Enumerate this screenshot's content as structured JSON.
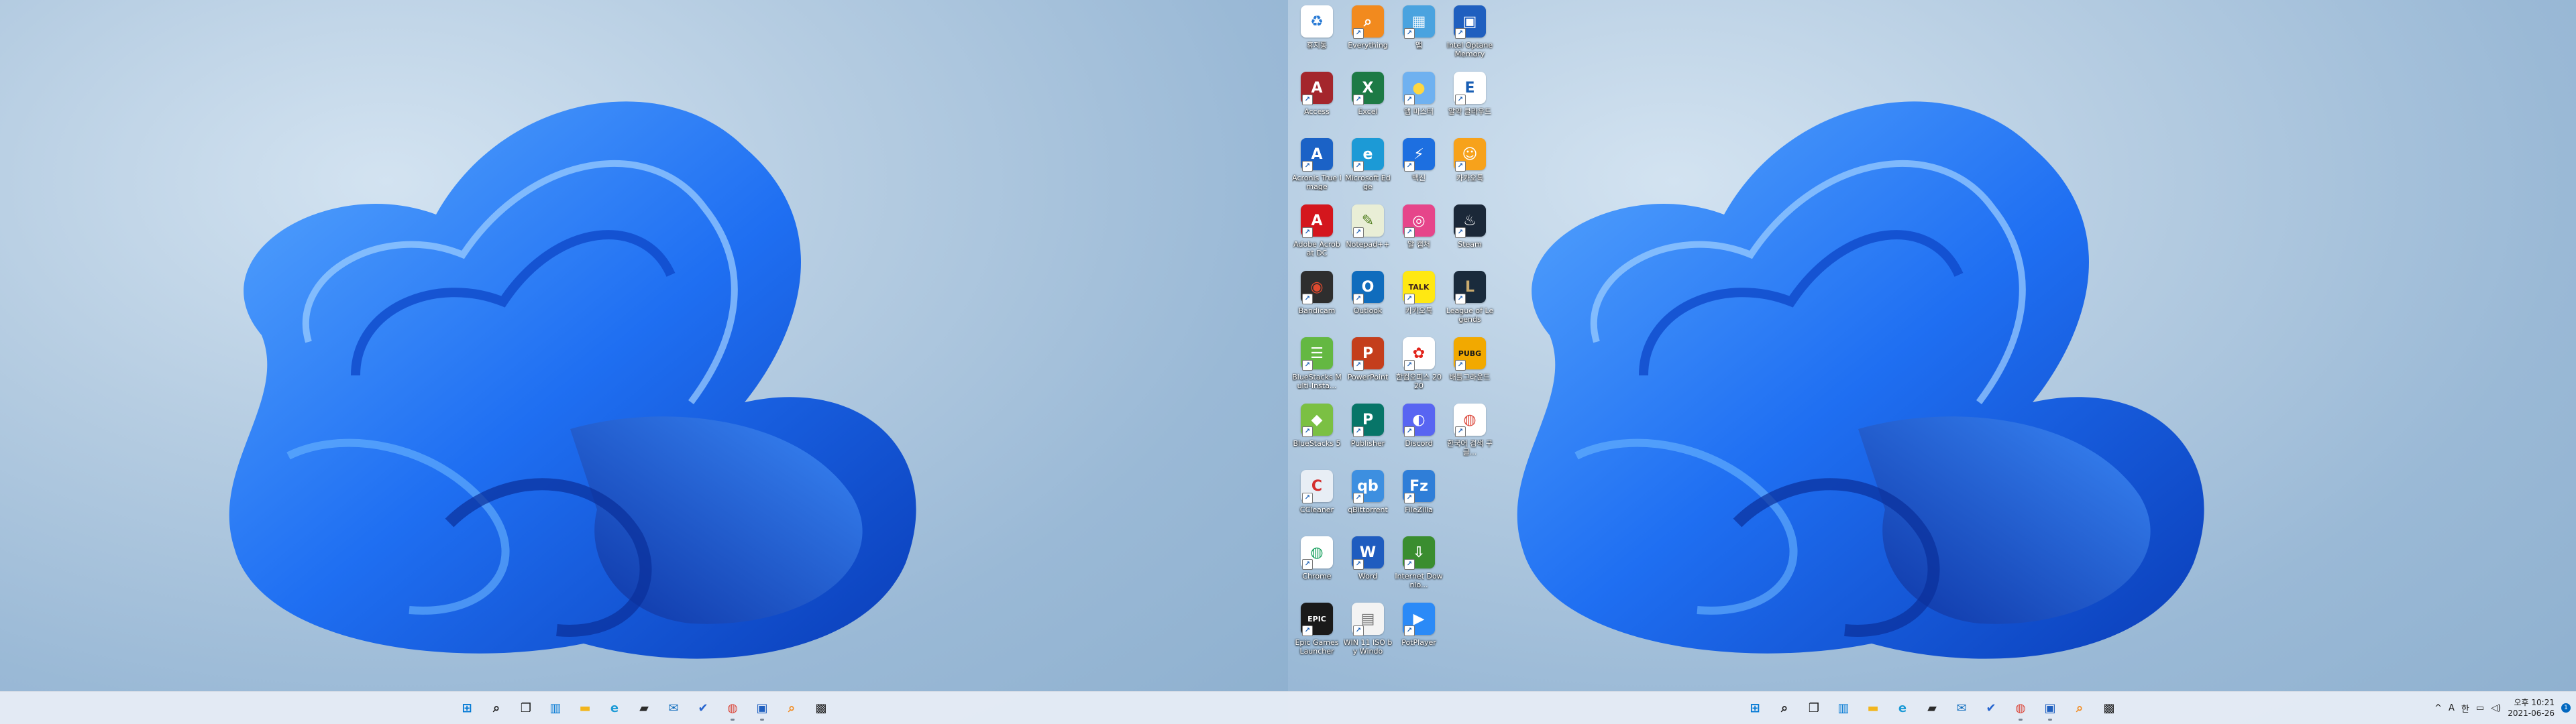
{
  "desktop_icons": [
    {
      "label": "휴지통",
      "icon": "recycle-bin-icon",
      "bg": "#ffffff",
      "fg": "#2a7bd5",
      "glyph": "♻"
    },
    {
      "label": "Everything",
      "icon": "search-magnifier-icon",
      "bg": "#f28a1e",
      "fg": "#ffffff",
      "glyph": "⌕"
    },
    {
      "label": "앱",
      "icon": "apps-folder-icon",
      "bg": "#4aa3df",
      "fg": "#ffffff",
      "glyph": "▦"
    },
    {
      "label": "Intel Optane Memory",
      "icon": "floppy-disk-icon",
      "bg": "#1f5fbf",
      "fg": "#ffffff",
      "glyph": "▣"
    },
    {
      "label": "Access",
      "icon": "access-app-icon",
      "bg": "#a4262c",
      "fg": "#ffffff",
      "glyph": "A"
    },
    {
      "label": "Excel",
      "icon": "excel-app-icon",
      "bg": "#1d7a45",
      "fg": "#ffffff",
      "glyph": "X"
    },
    {
      "label": "앱 마스터",
      "icon": "sun-cloud-icon",
      "bg": "#6fb1f0",
      "fg": "#ffd740",
      "glyph": "●"
    },
    {
      "label": "알약 클라우드",
      "icon": "ebs-logo-icon",
      "bg": "#ffffff",
      "fg": "#1a5fb4",
      "glyph": "E"
    },
    {
      "label": "Acronis True Image",
      "icon": "acronis-icon",
      "bg": "#1b62c6",
      "fg": "#ffffff",
      "glyph": "A"
    },
    {
      "label": "Microsoft Edge",
      "icon": "edge-browser-icon",
      "bg": "#1c9ad6",
      "fg": "#ffffff",
      "glyph": "e"
    },
    {
      "label": "백신",
      "icon": "lightning-shield-icon",
      "bg": "#1d6fe0",
      "fg": "#ffffff",
      "glyph": "⚡"
    },
    {
      "label": "카카오톡",
      "icon": "smile-face-icon",
      "bg": "#f7a21b",
      "fg": "#ffffff",
      "glyph": "☺"
    },
    {
      "label": "Adobe Acrobat DC",
      "icon": "acrobat-pdf-icon",
      "bg": "#d4161d",
      "fg": "#ffffff",
      "glyph": "A"
    },
    {
      "label": "Notepad++",
      "icon": "notepad-plus-icon",
      "bg": "#e9eed6",
      "fg": "#4f7d1e",
      "glyph": "✎"
    },
    {
      "label": "알 캡처",
      "icon": "color-wheel-icon",
      "bg": "#e6458a",
      "fg": "#ffffff",
      "glyph": "◎"
    },
    {
      "label": "Steam",
      "icon": "steam-icon",
      "bg": "#1b2838",
      "fg": "#ffffff",
      "glyph": "♨"
    },
    {
      "label": "Bandicam",
      "icon": "bandicam-icon",
      "bg": "#2e2e2e",
      "fg": "#e04a2f",
      "glyph": "◉"
    },
    {
      "label": "Outlook",
      "icon": "outlook-app-icon",
      "bg": "#0f6cbd",
      "fg": "#ffffff",
      "glyph": "O"
    },
    {
      "label": "카카오톡",
      "icon": "kakaotalk-icon",
      "bg": "#ffe812",
      "fg": "#3c1e1e",
      "glyph": "TALK"
    },
    {
      "label": "League of Legends",
      "icon": "league-of-legends-icon",
      "bg": "#1a2b3c",
      "fg": "#c8aa6e",
      "glyph": "L"
    },
    {
      "label": "BlueStacks Multi-Insta...",
      "icon": "bluestacks-multi-icon",
      "bg": "#64b842",
      "fg": "#ffffff",
      "glyph": "☰"
    },
    {
      "label": "PowerPoint",
      "icon": "powerpoint-app-icon",
      "bg": "#c43e1c",
      "fg": "#ffffff",
      "glyph": "P"
    },
    {
      "label": "한컴오피스 2020",
      "icon": "hancom-office-icon",
      "bg": "#ffffff",
      "fg": "#e2231a",
      "glyph": "✿"
    },
    {
      "label": "배틀그라운드",
      "icon": "pubg-icon",
      "bg": "#f2a900",
      "fg": "#1a1a1a",
      "glyph": "PUBG"
    },
    {
      "label": "BlueStacks 5",
      "icon": "bluestacks-icon",
      "bg": "#7bc043",
      "fg": "#ffffff",
      "glyph": "◆"
    },
    {
      "label": "Publisher",
      "icon": "publisher-app-icon",
      "bg": "#077568",
      "fg": "#ffffff",
      "glyph": "P"
    },
    {
      "label": "Discord",
      "icon": "discord-icon",
      "bg": "#5865f2",
      "fg": "#ffffff",
      "glyph": "◐"
    },
    {
      "label": "한국어 검색 구글...",
      "icon": "chrome-google-icon",
      "bg": "#ffffff",
      "fg": "#db4437",
      "glyph": "◍"
    },
    {
      "label": "CCleaner",
      "icon": "ccleaner-icon",
      "bg": "#e8eef5",
      "fg": "#d32f2f",
      "glyph": "C"
    },
    {
      "label": "qBittorrent",
      "icon": "qbittorrent-icon",
      "bg": "#3d8fe0",
      "fg": "#ffffff",
      "glyph": "qb"
    },
    {
      "label": "FileZilla",
      "icon": "filezilla-icon",
      "bg": "#2f7ed8",
      "fg": "#ffffff",
      "glyph": "Fz"
    },
    {
      "label": "",
      "icon": "",
      "bg": "",
      "fg": "",
      "glyph": ""
    },
    {
      "label": "Chrome",
      "icon": "chrome-browser-icon",
      "bg": "#ffffff",
      "fg": "#0f9d58",
      "glyph": "◍"
    },
    {
      "label": "Word",
      "icon": "word-app-icon",
      "bg": "#1f5cbf",
      "fg": "#ffffff",
      "glyph": "W"
    },
    {
      "label": "Internet Downlo...",
      "icon": "internet-download-manager-icon",
      "bg": "#3a8d2f",
      "fg": "#ffffff",
      "glyph": "⇩"
    },
    {
      "label": "",
      "icon": "",
      "bg": "",
      "fg": "",
      "glyph": ""
    },
    {
      "label": "Epic Games Launcher",
      "icon": "epic-games-icon",
      "bg": "#1a1a1a",
      "fg": "#ffffff",
      "glyph": "EPIC"
    },
    {
      "label": "WIN 11 ISO by Windo",
      "icon": "document-file-icon",
      "bg": "#f3f3f3",
      "fg": "#777777",
      "glyph": "▤"
    },
    {
      "label": "PotPlayer",
      "icon": "potplayer-icon",
      "bg": "#2b8af7",
      "fg": "#ffffff",
      "glyph": "▶"
    }
  ],
  "taskbar_icons": [
    {
      "name": "start-button",
      "icon": "windows-logo-icon",
      "glyph": "⊞",
      "color": "#0078d4",
      "running": false
    },
    {
      "name": "search-button",
      "icon": "search-icon",
      "glyph": "⌕",
      "color": "#1c1c1c",
      "running": false
    },
    {
      "name": "task-view-button",
      "icon": "task-view-icon",
      "glyph": "❐",
      "color": "#1c1c1c",
      "running": false
    },
    {
      "name": "widgets-button",
      "icon": "widgets-icon",
      "glyph": "▥",
      "color": "#0078d4",
      "running": false
    },
    {
      "name": "file-explorer-button",
      "icon": "folder-icon",
      "glyph": "▬",
      "color": "#f2b51d",
      "running": false
    },
    {
      "name": "edge-button",
      "icon": "edge-browser-icon",
      "glyph": "e",
      "color": "#1c9ad6",
      "running": false
    },
    {
      "name": "store-button",
      "icon": "store-bag-icon",
      "glyph": "▰",
      "color": "#2b2b2b",
      "running": false
    },
    {
      "name": "mail-button",
      "icon": "mail-icon",
      "glyph": "✉",
      "color": "#0f6cbd",
      "running": false
    },
    {
      "name": "todo-button",
      "icon": "check-icon",
      "glyph": "✔",
      "color": "#2564cf",
      "running": false
    },
    {
      "name": "chrome-button",
      "icon": "chrome-browser-icon",
      "glyph": "◍",
      "color": "#db4437",
      "running": true
    },
    {
      "name": "optane-button",
      "icon": "floppy-disk-icon",
      "glyph": "▣",
      "color": "#1f5fbf",
      "running": true
    },
    {
      "name": "everything-button",
      "icon": "search-magnifier-icon",
      "glyph": "⌕",
      "color": "#f28a1e",
      "running": false
    },
    {
      "name": "capture-button",
      "icon": "camera-icon",
      "glyph": "▩",
      "color": "#1c1c1c",
      "running": false
    }
  ],
  "tray": {
    "chevron": "^",
    "ime": "A",
    "lang": "한",
    "clock_period": "오후 10:21",
    "date": "2021-06-26",
    "notifications": "1"
  }
}
